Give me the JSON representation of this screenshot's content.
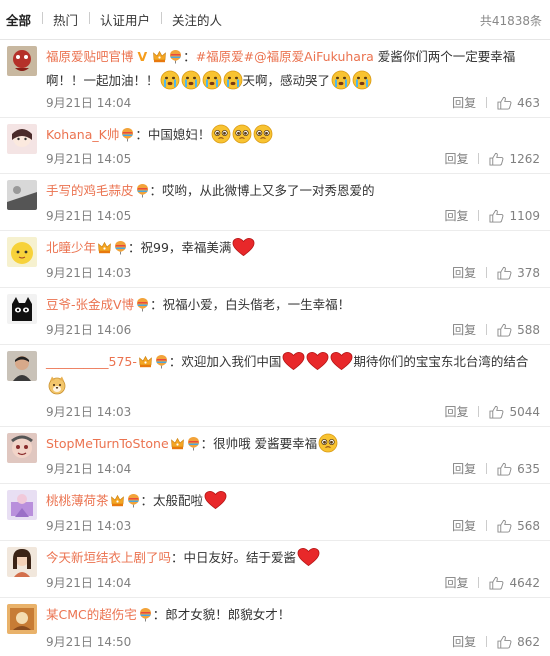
{
  "tabs": [
    {
      "label": "全部"
    },
    {
      "label": "热门"
    },
    {
      "label": "认证用户"
    },
    {
      "label": "关注的人"
    }
  ],
  "total": "共41838条",
  "reply_label": "回复",
  "comments": [
    {
      "user": "福原爱贴吧官博",
      "v": "V",
      "text_a": "：",
      "topic1": "#福原爱#",
      "mention": "@福原爱AiFukuhara",
      "text_b": " 爱酱你们两个一定要幸福啊！！一起加油！！",
      "text_c": "天啊，感动哭了",
      "time": "9月21日 14:04",
      "likes": "463"
    },
    {
      "user": "Kohana_K帅",
      "text": "：中国媳妇！",
      "time": "9月21日 14:05",
      "likes": "1262"
    },
    {
      "user": "手写的鸡毛蒜皮",
      "text": "：哎哟，从此微博上又多了一对秀恩爱的",
      "time": "9月21日 14:05",
      "likes": "1109"
    },
    {
      "user": "北瞳少年",
      "text": "：祝99，幸福美满",
      "time": "9月21日 14:03",
      "likes": "378"
    },
    {
      "user": "豆爷-张金成V博",
      "text": "：祝福小爱，白头偕老，一生幸福！",
      "time": "9月21日 14:06",
      "likes": "588"
    },
    {
      "user": "__________575-",
      "text_a": "：欢迎加入我们中国",
      "text_b": "期待你们的宝宝东北台湾的结合",
      "time": "9月21日 14:03",
      "likes": "5044"
    },
    {
      "user": "StopMeTurnToStone",
      "text": "：很帅哦 爱酱要幸福",
      "time": "9月21日 14:04",
      "likes": "635"
    },
    {
      "user": "桃桃薄荷茶",
      "text": "：太般配啦",
      "time": "9月21日 14:03",
      "likes": "568"
    },
    {
      "user": "今天新垣结衣上剧了吗",
      "text": "：中日友好。结于爱酱",
      "time": "9月21日 14:04",
      "likes": "4642"
    },
    {
      "user": "某CMC的超伤宅",
      "text": "：郎才女貌！郎貌女才！",
      "time": "9月21日 14:50",
      "likes": "862"
    }
  ]
}
